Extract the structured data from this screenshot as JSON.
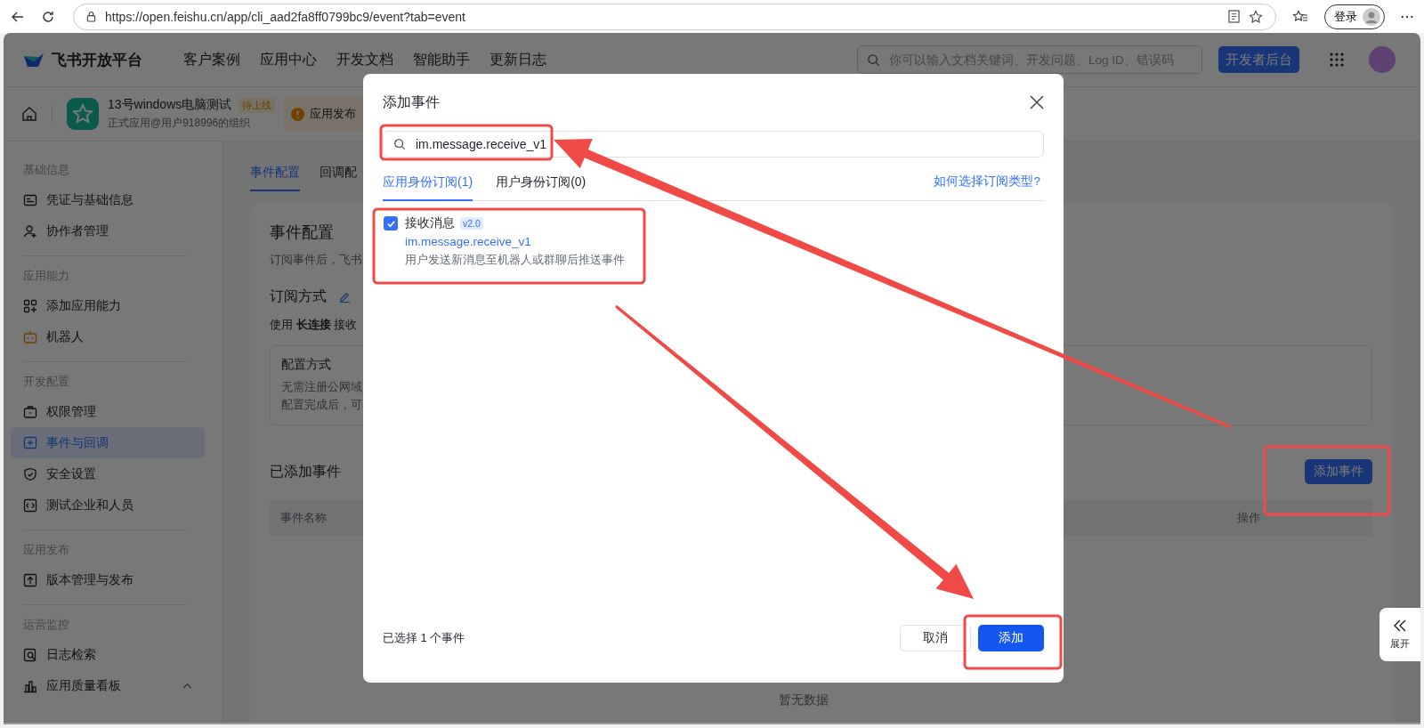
{
  "browser": {
    "url": "https://open.feishu.cn/app/cli_aad2fa8ff0799bc9/event?tab=event",
    "account_button": "登录"
  },
  "header": {
    "logo_text": "飞书开放平台",
    "nav": [
      "客户案例",
      "应用中心",
      "开发文档",
      "智能助手",
      "更新日志"
    ],
    "search": {
      "placeholder": "你可以输入文档关键词、开发问题、Log ID、错误码"
    },
    "console_button": "开发者后台"
  },
  "app_bar": {
    "app_name": "13号windows电脑测试",
    "status_badge": "待上线",
    "subtitle": "正式应用@用户918996的组织",
    "notice": "应用发布"
  },
  "sidebar": {
    "groups": [
      {
        "heading": "基础信息",
        "items": [
          {
            "label": "凭证与基础信息",
            "selected": false
          },
          {
            "label": "协作者管理",
            "selected": false
          }
        ]
      },
      {
        "heading": "应用能力",
        "items": [
          {
            "label": "添加应用能力",
            "selected": false
          },
          {
            "label": "机器人",
            "selected": false
          }
        ]
      },
      {
        "heading": "开发配置",
        "items": [
          {
            "label": "权限管理",
            "selected": false
          },
          {
            "label": "事件与回调",
            "selected": true
          },
          {
            "label": "安全设置",
            "selected": false
          },
          {
            "label": "测试企业和人员",
            "selected": false
          }
        ]
      },
      {
        "heading": "应用发布",
        "items": [
          {
            "label": "版本管理与发布",
            "selected": false
          }
        ]
      },
      {
        "heading": "运营监控",
        "items": [
          {
            "label": "日志检索",
            "selected": false
          },
          {
            "label": "应用质量看板",
            "selected": false,
            "expanded": true
          }
        ]
      }
    ]
  },
  "content": {
    "tabs": [
      {
        "label": "事件配置",
        "selected": true
      },
      {
        "label": "回调配",
        "selected": false
      }
    ],
    "title": "事件配置",
    "description": "订阅事件后，飞书",
    "subscription_heading": "订阅方式",
    "subscription_text": "使用 **长连接** 接收",
    "config_box": {
      "title": "配置方式",
      "lines": [
        "无需注册公网域",
        "配置完成后，可"
      ]
    },
    "added_events": {
      "title": "已添加事件",
      "add_button": "添加事件",
      "columns": [
        "事件名称",
        "操作"
      ],
      "empty_text": "暂无数据"
    }
  },
  "modal": {
    "title": "添加事件",
    "search": {
      "value": "im.message.receive_v1"
    },
    "tabs": [
      {
        "label": "应用身份订阅(1)",
        "selected": true
      },
      {
        "label": "用户身份订阅(0)",
        "selected": false
      }
    ],
    "help_link": "如何选择订阅类型?",
    "events": [
      {
        "name": "接收消息",
        "version": "v2.0",
        "key": "im.message.receive_v1",
        "description": "用户发送新消息至机器人或群聊后推送事件",
        "checked": true
      }
    ],
    "selection_summary": "已选择 1 个事件",
    "cancel_button": "取消",
    "confirm_button": "添加"
  },
  "expand_button": "展开"
}
